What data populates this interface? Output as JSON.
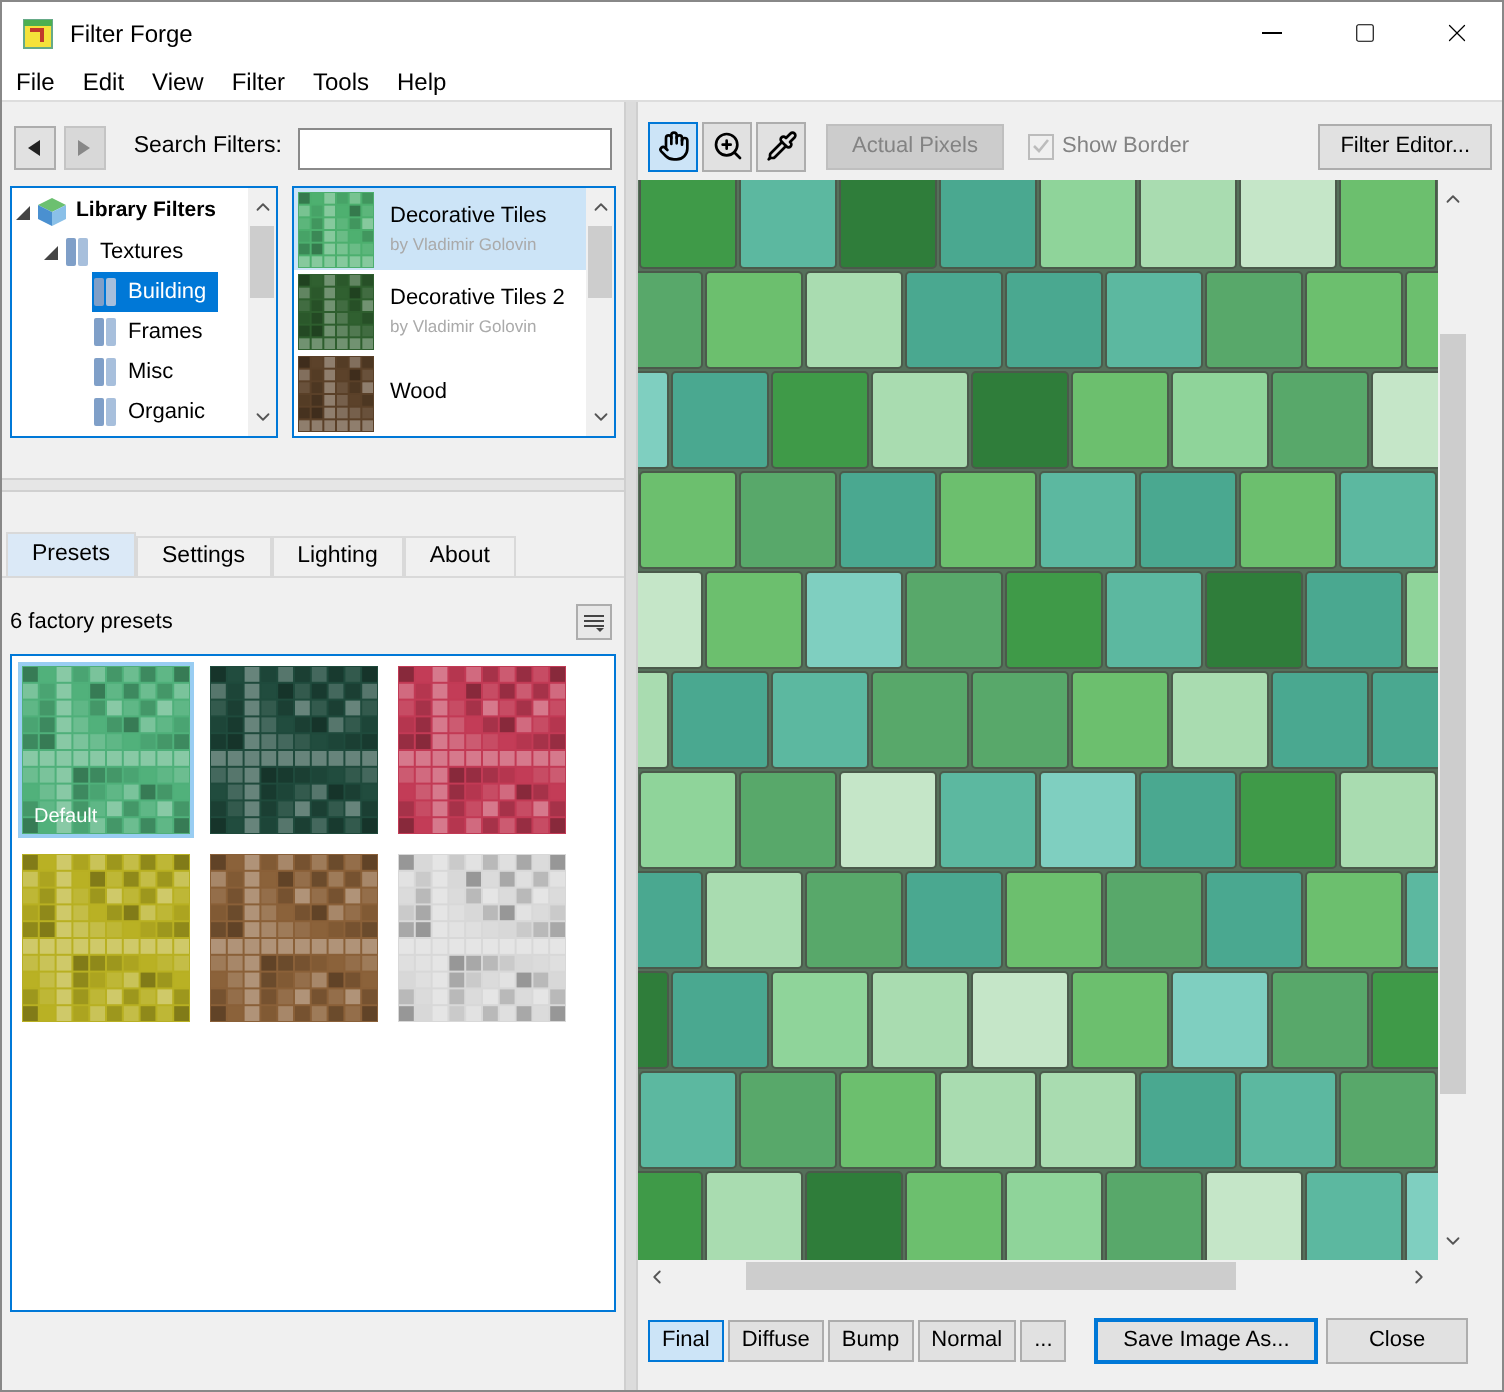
{
  "window": {
    "title": "Filter Forge"
  },
  "menu": [
    "File",
    "Edit",
    "View",
    "Filter",
    "Tools",
    "Help"
  ],
  "browser": {
    "search_label": "Search Filters:",
    "tree": [
      {
        "label": "Library Filters",
        "kind": "library",
        "expanded": true,
        "selected": false,
        "children": [
          {
            "label": "Textures",
            "kind": "folder",
            "expanded": true,
            "selected": false,
            "children": [
              {
                "label": "Building",
                "kind": "folder",
                "selected": true
              },
              {
                "label": "Frames",
                "kind": "folder",
                "selected": false
              },
              {
                "label": "Misc",
                "kind": "folder",
                "selected": false
              },
              {
                "label": "Organic",
                "kind": "folder",
                "selected": false
              }
            ]
          }
        ]
      }
    ],
    "filters": [
      {
        "name": "Decorative Tiles",
        "author": "by Vladimir Golovin",
        "selected": true,
        "color": "#4caf6e"
      },
      {
        "name": "Decorative Tiles 2",
        "author": "by Vladimir Golovin",
        "selected": false,
        "color": "#2e5e2e"
      },
      {
        "name": "Wood",
        "selected": false,
        "color": "#5a4028"
      }
    ]
  },
  "tabs": [
    {
      "label": "Presets",
      "selected": true
    },
    {
      "label": "Settings",
      "selected": false
    },
    {
      "label": "Lighting",
      "selected": false
    },
    {
      "label": "About",
      "selected": false
    }
  ],
  "presets": {
    "count": "6 factory presets",
    "items": [
      {
        "label": "Default",
        "selected": true,
        "color": "#4fb07a"
      },
      {
        "selected": false,
        "color": "#1f4a3c"
      },
      {
        "selected": false,
        "color": "#c23a55"
      },
      {
        "selected": false,
        "color": "#b8b022"
      },
      {
        "selected": false,
        "color": "#8a6038"
      },
      {
        "selected": false,
        "color": "#d8d8d8"
      }
    ]
  },
  "toolbar": {
    "tools": [
      {
        "kind": "hand",
        "selected": true
      },
      {
        "kind": "zoom",
        "selected": false
      },
      {
        "kind": "eyedropper",
        "selected": false
      }
    ],
    "actual_pixels": {
      "label": "Actual Pixels",
      "disabled": true
    },
    "show_border": {
      "label": "Show Border",
      "checked": true,
      "disabled": true
    },
    "filter_editor": "Filter Editor..."
  },
  "view_modes": [
    {
      "label": "Final",
      "selected": true
    },
    {
      "label": "Diffuse",
      "selected": false
    },
    {
      "label": "Bump",
      "selected": false
    },
    {
      "label": "Normal",
      "selected": false
    },
    {
      "label": "...",
      "selected": false
    }
  ],
  "save_button": "Save Image As...",
  "close_button": "Close"
}
